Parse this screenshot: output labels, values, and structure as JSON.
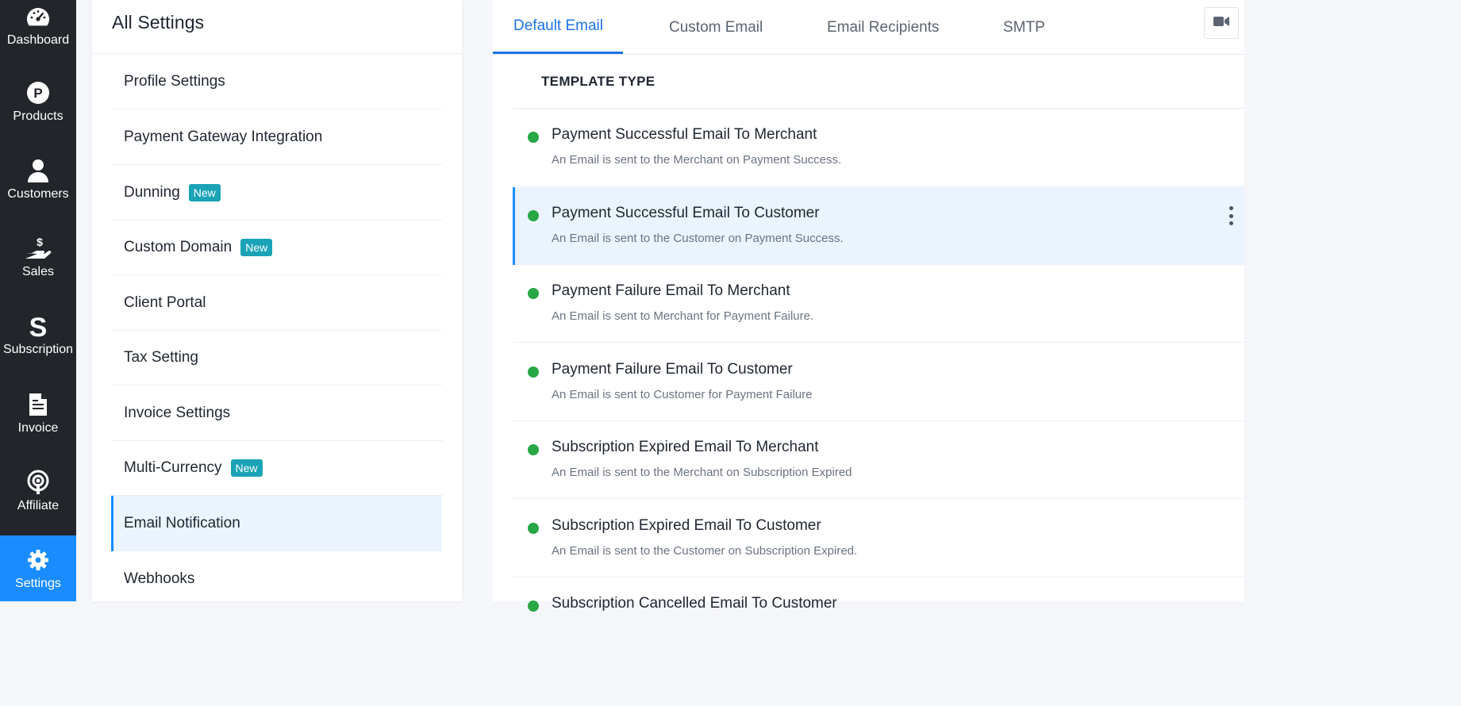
{
  "nav": {
    "items": [
      {
        "label": "Dashboard",
        "icon": "speedometer-icon"
      },
      {
        "label": "Products",
        "icon": "product-p-icon"
      },
      {
        "label": "Customers",
        "icon": "user-icon"
      },
      {
        "label": "Sales",
        "icon": "hand-dollar-icon"
      },
      {
        "label": "Subscription",
        "icon": "subscription-s-icon"
      },
      {
        "label": "Invoice",
        "icon": "document-icon"
      },
      {
        "label": "Affiliate",
        "icon": "broadcast-icon"
      },
      {
        "label": "Settings",
        "icon": "gear-icon"
      }
    ],
    "active": "Settings"
  },
  "settings_list": {
    "title": "All Settings",
    "items": [
      {
        "label": "Profile Settings"
      },
      {
        "label": "Payment Gateway Integration"
      },
      {
        "label": "Dunning",
        "badge": "New"
      },
      {
        "label": "Custom Domain",
        "badge": "New"
      },
      {
        "label": "Client Portal"
      },
      {
        "label": "Tax Setting"
      },
      {
        "label": "Invoice Settings"
      },
      {
        "label": "Multi-Currency",
        "badge": "New"
      },
      {
        "label": "Email Notification"
      },
      {
        "label": "Webhooks"
      }
    ],
    "active": "Email Notification"
  },
  "tabs": {
    "items": [
      "Default Email",
      "Custom Email",
      "Email Recipients",
      "SMTP"
    ],
    "active": "Default Email",
    "video_icon": "video-camera-icon"
  },
  "templates": {
    "header": "TEMPLATE TYPE",
    "items": [
      {
        "title": "Payment Successful Email To Merchant",
        "desc": "An Email is sent to the Merchant on Payment Success."
      },
      {
        "title": "Payment Successful Email To Customer",
        "desc": "An Email is sent to the Customer on Payment Success."
      },
      {
        "title": "Payment Failure Email To Merchant",
        "desc": "An Email is sent to Merchant for Payment Failure."
      },
      {
        "title": "Payment Failure Email To Customer",
        "desc": "An Email is sent to Customer for Payment Failure"
      },
      {
        "title": "Subscription Expired Email To Merchant",
        "desc": "An Email is sent to the Merchant on Subscription Expired"
      },
      {
        "title": "Subscription Expired Email To Customer",
        "desc": "An Email is sent to the Customer on Subscription Expired."
      },
      {
        "title": "Subscription Cancelled Email To Customer",
        "desc": ""
      }
    ],
    "active_index": 1,
    "status_color": "#28a745"
  },
  "colors": {
    "nav_bg": "#22262b",
    "accent": "#1a8cff",
    "badge": "#1aa3b6",
    "active_bg": "#eaf3fe"
  }
}
